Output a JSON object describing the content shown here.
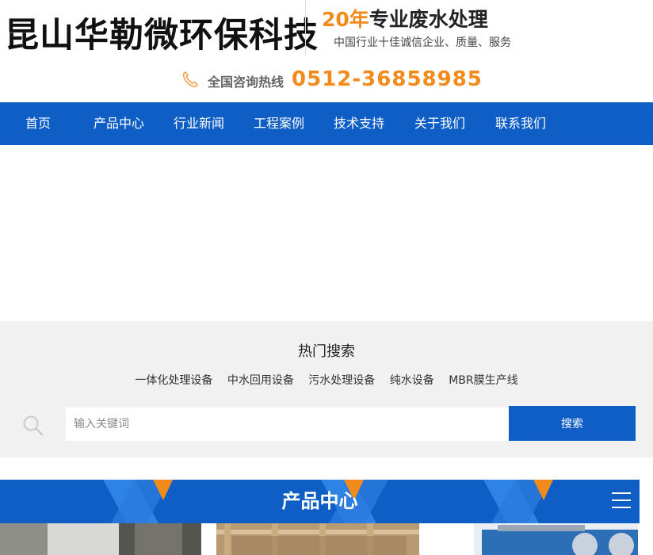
{
  "header": {
    "logo_text": "昆山华勒微环保科技",
    "slogan_accent": "20年",
    "slogan_rest": "专业废水处理",
    "slogan_sub": "中国行业十佳诚信企业、质量、服务",
    "hotline_label": "全国咨询热线",
    "hotline_number": "0512-36858985",
    "accent_color": "#f28a1c"
  },
  "nav": {
    "color": "#0f5ec6",
    "items": [
      {
        "label": "首页"
      },
      {
        "label": "产品中心"
      },
      {
        "label": "行业新闻"
      },
      {
        "label": "工程案例"
      },
      {
        "label": "技术支持"
      },
      {
        "label": "关于我们"
      },
      {
        "label": "联系我们"
      }
    ]
  },
  "hot_search": {
    "title": "热门搜索",
    "links": [
      "一体化处理设备",
      "中水回用设备",
      "污水处理设备",
      "纯水设备",
      "MBR膜生产线"
    ],
    "placeholder": "输入关键词",
    "button_label": "搜索"
  },
  "product_center": {
    "title": "产品中心"
  },
  "icons": [
    "phone-icon",
    "search-icon",
    "menu-icon"
  ]
}
